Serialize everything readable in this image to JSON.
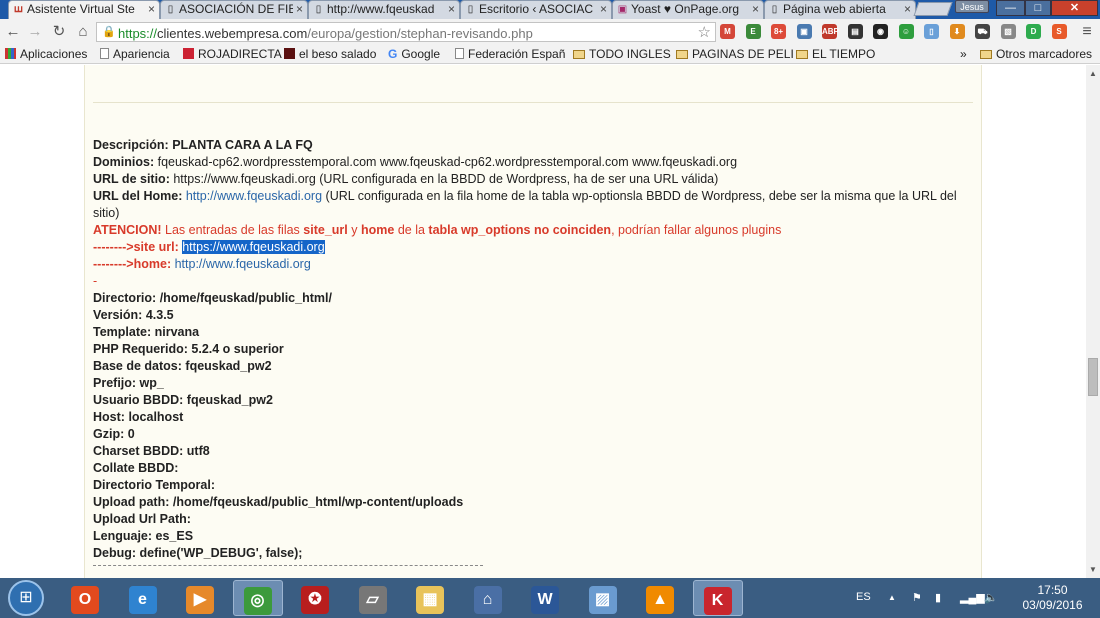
{
  "browser": {
    "tabs": [
      {
        "label": "Asistente Virtual Ste",
        "favicon": "webempresa-icon",
        "active": true
      },
      {
        "label": "ASOCIACIÓN DE FIB",
        "favicon": "page-icon",
        "active": false
      },
      {
        "label": "http://www.fqeuskad",
        "favicon": "page-icon",
        "active": false
      },
      {
        "label": "Escritorio ‹ ASOCIAC",
        "favicon": "page-icon",
        "active": false
      },
      {
        "label": "Yoast ♥ OnPage.org",
        "favicon": "yoast-icon",
        "active": false
      },
      {
        "label": "Página web abierta",
        "favicon": "page-icon",
        "active": false
      }
    ],
    "tab_close_glyph": "×",
    "user_badge": "Jesus",
    "window_controls": {
      "minimize": "—",
      "maximize": "□",
      "close": "✕"
    },
    "url": {
      "scheme": "https://",
      "host": "clientes.webempresa.com",
      "path": "/europa/gestion/stephan-revisando.php"
    },
    "extensions": [
      {
        "name": "gmail-icon",
        "color": "#d44638",
        "glyph": "M"
      },
      {
        "name": "evernote-icon",
        "color": "#3b8a3a",
        "glyph": "E"
      },
      {
        "name": "google-plus-icon",
        "color": "#dd4b39",
        "glyph": "8+"
      },
      {
        "name": "screen-capture-icon",
        "color": "#4a7ab0",
        "glyph": "▣"
      },
      {
        "name": "adblock-plus-icon",
        "color": "#c0392b",
        "glyph": "ABP"
      },
      {
        "name": "film-icon",
        "color": "#333333",
        "glyph": "▤"
      },
      {
        "name": "dark-circle-icon",
        "color": "#222222",
        "glyph": "◉"
      },
      {
        "name": "green-face-icon",
        "color": "#2e9e3e",
        "glyph": "☺"
      },
      {
        "name": "doc-icon",
        "color": "#6aa0d8",
        "glyph": "▯"
      },
      {
        "name": "download-icon",
        "color": "#e08a1e",
        "glyph": "⬇"
      },
      {
        "name": "car-icon",
        "color": "#444444",
        "glyph": "⛟"
      },
      {
        "name": "gray-square-icon",
        "color": "#888888",
        "glyph": "▧"
      },
      {
        "name": "green-d-icon",
        "color": "#2eab4e",
        "glyph": "D"
      },
      {
        "name": "s-logo-icon",
        "color": "#e85a2a",
        "glyph": "S"
      }
    ],
    "menu_glyph": "≡",
    "bookmarks": [
      {
        "label": "Aplicaciones",
        "icon": "apps-grid-icon"
      },
      {
        "label": "Apariencia",
        "icon": "page-icon"
      },
      {
        "label": "ROJADIRECTA",
        "icon": "rojadirecta-icon"
      },
      {
        "label": "el beso salado",
        "icon": "blog-icon"
      },
      {
        "label": "Google",
        "icon": "google-icon"
      },
      {
        "label": "Federación Españ",
        "icon": "page-icon"
      },
      {
        "label": "TODO INGLES",
        "icon": "folder-icon"
      },
      {
        "label": "PAGINAS DE PELI",
        "icon": "folder-icon"
      },
      {
        "label": "EL TIEMPO",
        "icon": "folder-icon"
      }
    ],
    "bookmarks_overflow": "»",
    "other_bookmarks": "Otros marcadores"
  },
  "details": {
    "descripcion": {
      "key": "Descripción:",
      "value": "PLANTA CARA A LA FQ"
    },
    "dominios": {
      "key": "Dominios:",
      "value": "fqeuskad-cp62.wordpresstemporal.com www.fqeuskad-cp62.wordpresstemporal.com www.fqeuskadi.org"
    },
    "url_sitio": {
      "key": "URL de sitio:",
      "value": "https://www.fqeuskadi.org (URL configurada en la BBDD de Wordpress, ha de ser una URL válida)"
    },
    "url_home": {
      "key": "URL del Home:",
      "link": "http://www.fqeuskadi.org",
      "note": "(URL configurada en la fila home de la tabla wp-optionsla BBDD de Wordpress, debe ser la misma que la URL del sitio)"
    },
    "atencion": {
      "label": "ATENCION!",
      "t1": "Las entradas de las filas",
      "site_url": "site_url",
      "t2": "y",
      "home": "home",
      "t3": "de la",
      "tabla": "tabla wp_options no coinciden",
      "t4": ", podrían fallar algunos plugins"
    },
    "site_url_line": {
      "key": "-------->site url:",
      "value": "https://www.fqeuskadi.org"
    },
    "home_line": {
      "key": "-------->home:",
      "value": "http://www.fqeuskadi.org"
    },
    "dash": "-",
    "fields": [
      {
        "key": "Directorio:",
        "value": "/home/fqeuskad/public_html/"
      },
      {
        "key": "Versión:",
        "value": "4.3.5"
      },
      {
        "key": "Template:",
        "value": "nirvana"
      },
      {
        "key": "PHP Requerido:",
        "value": "5.2.4 o superior"
      },
      {
        "key": "Base de datos:",
        "value": "fqeuskad_pw2"
      },
      {
        "key": "Prefijo:",
        "value": "wp_"
      },
      {
        "key": "Usuario BBDD:",
        "value": "fqeuskad_pw2"
      },
      {
        "key": "Host:",
        "value": "localhost"
      },
      {
        "key": "Gzip:",
        "value": "0"
      },
      {
        "key": "Charset BBDD:",
        "value": "utf8"
      },
      {
        "key": "Collate BBDD:",
        "value": ""
      },
      {
        "key": "Directorio Temporal:",
        "value": ""
      },
      {
        "key": "Upload path:",
        "value": "/home/fqeuskad/public_html/wp-content/uploads"
      },
      {
        "key": "Upload Url Path:",
        "value": ""
      },
      {
        "key": "Lenguaje:",
        "value": "es_ES"
      },
      {
        "key": "Debug:",
        "value": "define('WP_DEBUG', false);"
      }
    ]
  },
  "taskbar": {
    "apps": [
      {
        "name": "office-icon",
        "color": "#e24a1e",
        "glyph": "O"
      },
      {
        "name": "internet-explorer-icon",
        "color": "#2f83d0",
        "glyph": "e"
      },
      {
        "name": "media-player-icon",
        "color": "#e6892a",
        "glyph": "▶"
      },
      {
        "name": "chrome-icon",
        "color": "#3c9a3c",
        "glyph": "◎"
      },
      {
        "name": "antivirus-red-icon",
        "color": "#b81e1e",
        "glyph": "✪"
      },
      {
        "name": "scanner-icon",
        "color": "#777777",
        "glyph": "▱"
      },
      {
        "name": "file-explorer-icon",
        "color": "#e8c35a",
        "glyph": "▦"
      },
      {
        "name": "graduation-icon",
        "color": "#4a6fa5",
        "glyph": "⌂"
      },
      {
        "name": "word-icon",
        "color": "#2b5797",
        "glyph": "W"
      },
      {
        "name": "image-viewer-icon",
        "color": "#6a9bd0",
        "glyph": "▨"
      },
      {
        "name": "vlc-icon",
        "color": "#f08a00",
        "glyph": "▲"
      },
      {
        "name": "kaspersky-icon",
        "color": "#c9252d",
        "glyph": "K"
      }
    ],
    "language": "ES",
    "tray_up": "▲",
    "time": "17:50",
    "date": "03/09/2016"
  }
}
